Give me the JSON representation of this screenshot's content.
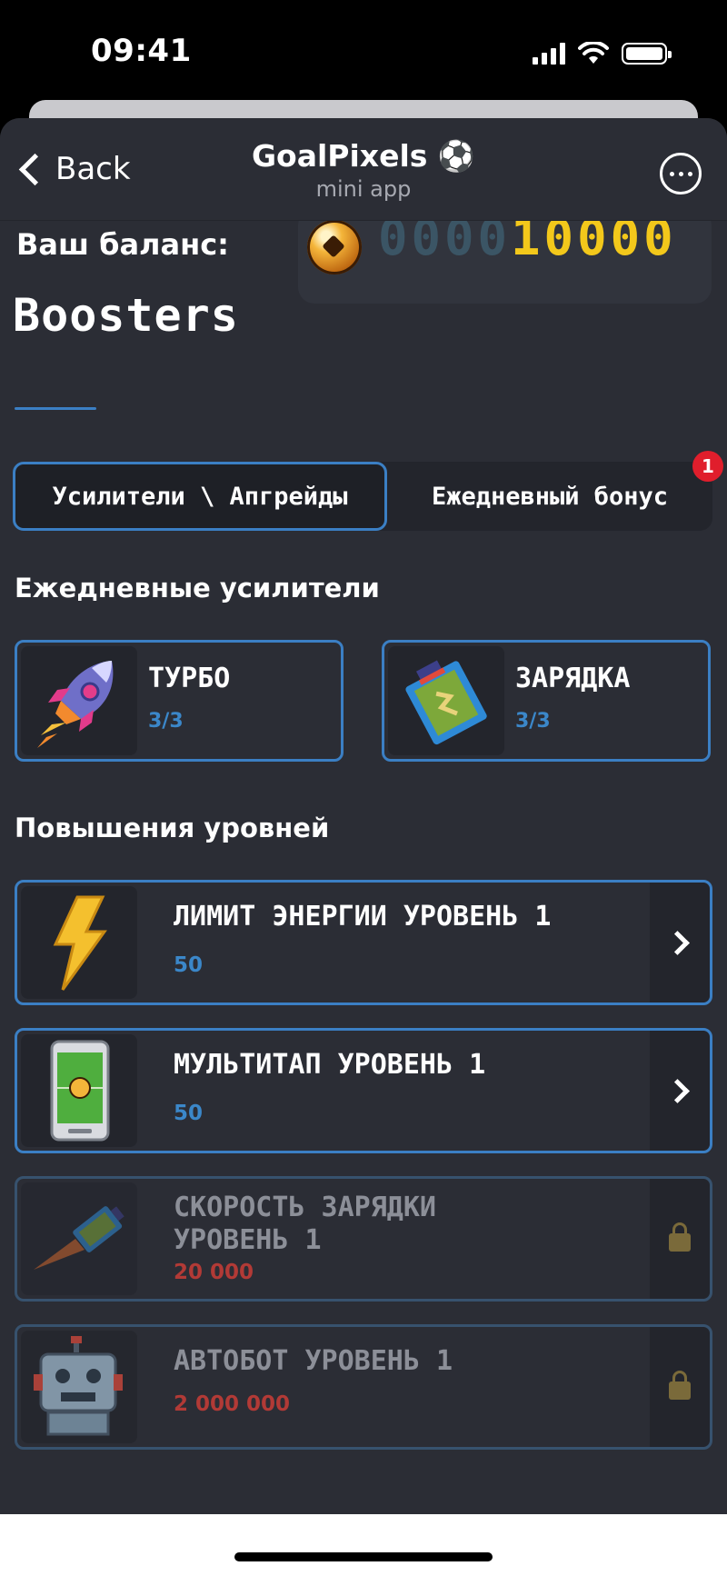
{
  "status_bar": {
    "time": "09:41"
  },
  "nav": {
    "back_label": "Back",
    "title": "GoalPixels ⚽",
    "subtitle": "mini app"
  },
  "balance": {
    "label": "Ваш баланс:",
    "digits_dim": "0000",
    "digits_lit": "10000"
  },
  "page": {
    "title": "Boosters"
  },
  "tabs": [
    {
      "label": "Усилители \\ Апгрейды",
      "active": true
    },
    {
      "label": "Ежедневный бонус",
      "badge": "1"
    }
  ],
  "daily": {
    "heading": "Ежедневные усилители",
    "items": [
      {
        "name": "ТУРБО",
        "count": "3/3",
        "icon": "rocket-icon"
      },
      {
        "name": "ЗАРЯДКА",
        "count": "3/3",
        "icon": "battery-icon"
      }
    ]
  },
  "upgrades": {
    "heading": "Повышения уровней",
    "items": [
      {
        "name": "ЛИМИТ ЭНЕРГИИ УРОВЕНЬ 1",
        "price": "50",
        "locked": false,
        "icon": "lightning-icon"
      },
      {
        "name": "МУЛЬТИТАП УРОВЕНЬ 1",
        "price": "50",
        "locked": false,
        "icon": "phone-icon"
      },
      {
        "name": "СКОРОСТЬ ЗАРЯДКИ УРОВЕНЬ 1",
        "price": "20 000",
        "locked": true,
        "icon": "flying-battery-icon"
      },
      {
        "name": "АВТОБОТ УРОВЕНЬ 1",
        "price": "2 000 000",
        "locked": true,
        "icon": "robot-icon"
      }
    ]
  },
  "colors": {
    "accent": "#3b7fc4",
    "background": "#2b2d35",
    "price_locked": "#b23a36",
    "balance_gold": "#f3c81b",
    "badge": "#e01e2c"
  }
}
